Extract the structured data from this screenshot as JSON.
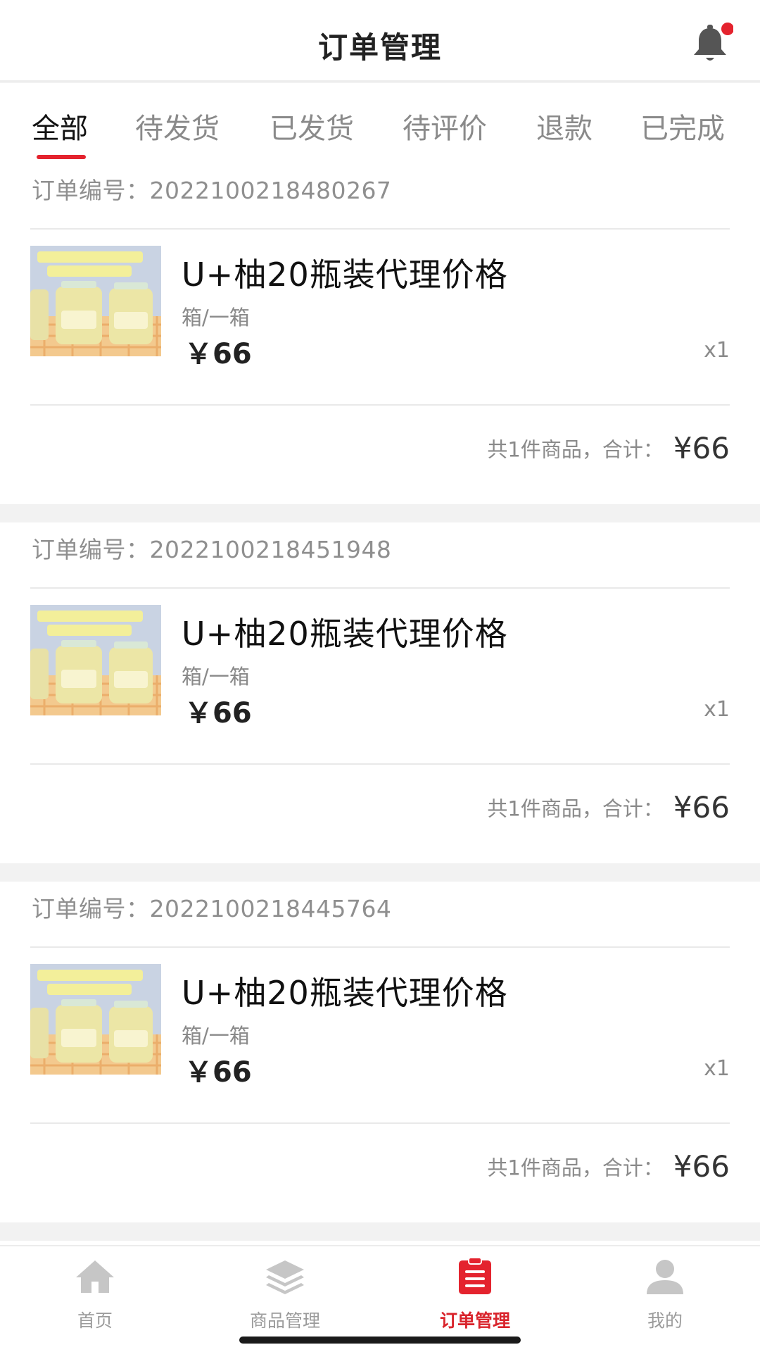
{
  "header": {
    "title": "订单管理",
    "bell_icon": "bell-icon",
    "badge_color": "#e4232e"
  },
  "tabs": [
    {
      "label": "全部",
      "active": true
    },
    {
      "label": "待发货",
      "active": false
    },
    {
      "label": "已发货",
      "active": false
    },
    {
      "label": "待评价",
      "active": false
    },
    {
      "label": "退款",
      "active": false
    },
    {
      "label": "已完成",
      "active": false
    }
  ],
  "orders": [
    {
      "order_no_label": "订单编号：",
      "order_no": "2022100218480267",
      "product_name": "U+柚20瓶装代理价格",
      "spec": "箱/一箱",
      "price": "￥66",
      "qty": "x1",
      "summary_label": "共1件商品，合计：",
      "total": "¥66"
    },
    {
      "order_no_label": "订单编号：",
      "order_no": "2022100218451948",
      "product_name": "U+柚20瓶装代理价格",
      "spec": "箱/一箱",
      "price": "￥66",
      "qty": "x1",
      "summary_label": "共1件商品，合计：",
      "total": "¥66"
    },
    {
      "order_no_label": "订单编号：",
      "order_no": "2022100218445764",
      "product_name": "U+柚20瓶装代理价格",
      "spec": "箱/一箱",
      "price": "￥66",
      "qty": "x1",
      "summary_label": "共1件商品，合计：",
      "total": "¥66"
    }
  ],
  "bottom_nav": [
    {
      "label": "首页",
      "icon": "home-icon",
      "active": false
    },
    {
      "label": "商品管理",
      "icon": "layers-icon",
      "active": false
    },
    {
      "label": "订单管理",
      "icon": "clipboard-icon",
      "active": true
    },
    {
      "label": "我的",
      "icon": "user-icon",
      "active": false
    }
  ],
  "colors": {
    "accent": "#e4232e",
    "active_nav": "#d9242c",
    "inactive": "#9b9b9b"
  }
}
